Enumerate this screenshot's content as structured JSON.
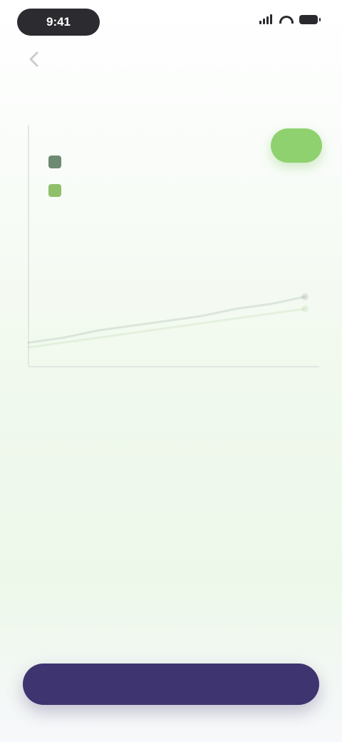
{
  "status_bar": {
    "time": "9:41"
  },
  "icons": {
    "back": "chevron-left-icon",
    "signal": "signal-icon",
    "wifi": "wifi-icon",
    "battery": "battery-icon"
  },
  "chart": {
    "y_title": "",
    "x_title": "",
    "badge": "",
    "colors": {
      "series_1": "#6f8a72",
      "series_2": "#8fbf6a",
      "axis": "#e2e6e2",
      "badge": "#8fd16f"
    }
  },
  "chart_data": {
    "type": "line",
    "x": [
      0,
      1,
      2,
      3,
      4,
      5,
      6,
      7,
      8
    ],
    "xlim": [
      0,
      8
    ],
    "ylim": [
      0,
      100
    ],
    "grid": false,
    "legend": "top-left",
    "series": [
      {
        "name": "",
        "values": [
          10,
          12,
          15,
          17,
          19,
          21,
          24,
          26,
          29
        ]
      },
      {
        "name": "",
        "values": [
          8,
          10,
          12,
          14,
          16,
          18,
          20,
          22,
          24
        ]
      }
    ]
  },
  "content": {
    "overline": "",
    "headline": "",
    "body": ""
  },
  "cta": {
    "label": ""
  },
  "colors": {
    "primary": "#3d3470",
    "accent": "#8fd16f"
  }
}
